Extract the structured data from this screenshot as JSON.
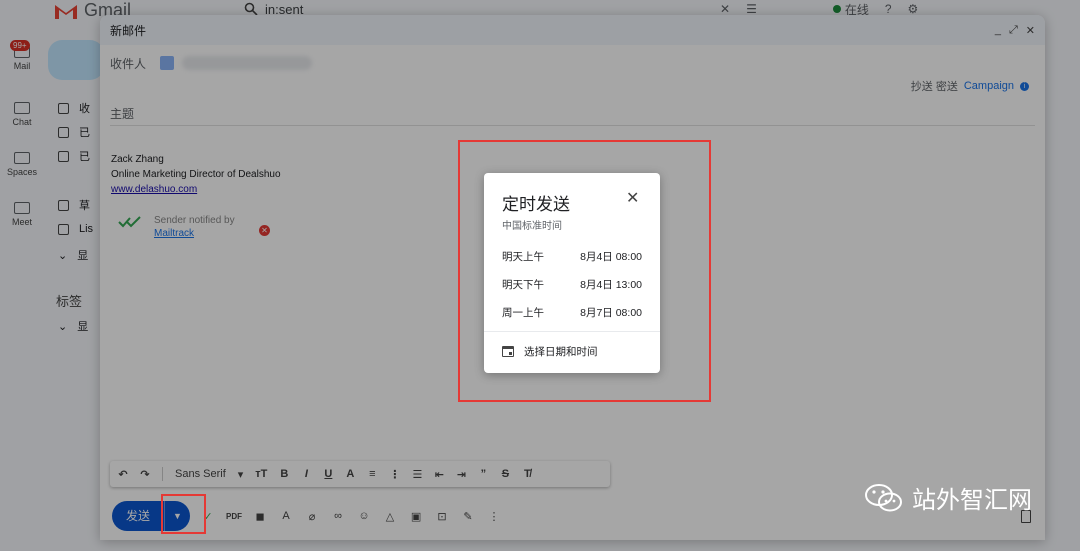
{
  "app": {
    "logo_text": "Gmail",
    "search_query": "in:sent",
    "status_label": "在线"
  },
  "rail": [
    {
      "label": "Mail",
      "badge": "99+"
    },
    {
      "label": "Chat"
    },
    {
      "label": "Spaces"
    },
    {
      "label": "Meet"
    }
  ],
  "nav": {
    "items": [
      "收",
      "已",
      "已",
      "草",
      "Lis",
      "显"
    ],
    "labels_header": "标签",
    "labels_item": "显"
  },
  "compose": {
    "title": "新邮件",
    "to_label": "收件人",
    "cc_bcc": "抄送 密送",
    "campaign": "Campaign",
    "subject_placeholder": "主题",
    "signature": {
      "name": "Zack Zhang",
      "role": "Online Marketing Director of Dealshuo",
      "link": "www.delashuo.com"
    },
    "mailtrack": {
      "notice": "Sender notified by",
      "link": "Mailtrack"
    },
    "format": {
      "font": "Sans Serif"
    },
    "send_label": "发送"
  },
  "schedule_dialog": {
    "title": "定时发送",
    "subtitle": "中国标准时间",
    "options": [
      {
        "label": "明天上午",
        "time": "8月4日 08:00"
      },
      {
        "label": "明天下午",
        "time": "8月4日 13:00"
      },
      {
        "label": "周一上午",
        "time": "8月7日 08:00"
      }
    ],
    "pick_label": "选择日期和时间"
  },
  "watermark": {
    "text": "站外智汇网"
  },
  "colors": {
    "accent": "#0b57d0",
    "annotation_red": "#e53935",
    "status_green": "#1e8e3e"
  }
}
